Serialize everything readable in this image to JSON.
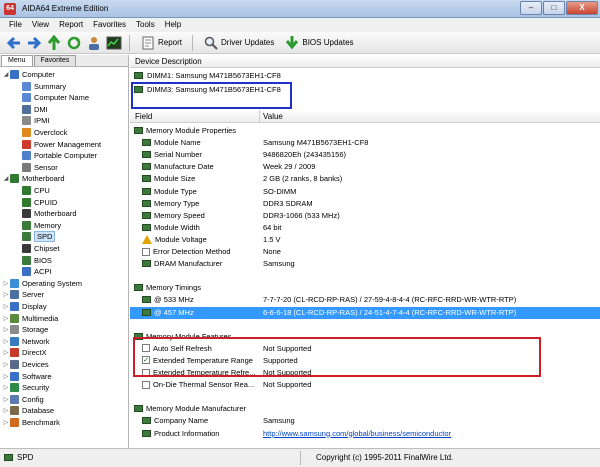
{
  "window": {
    "title": "AIDA64 Extreme Edition",
    "app_icon": "64",
    "minimize": "–",
    "maximize": "□",
    "close": "X"
  },
  "menubar": [
    "File",
    "View",
    "Report",
    "Favorites",
    "Tools",
    "Help"
  ],
  "toolbar": {
    "report": "Report",
    "driver_updates": "Driver Updates",
    "bios_updates": "BIOS Updates"
  },
  "left_tabs": [
    "Menu",
    "Favorites"
  ],
  "tree": [
    {
      "label": "Computer",
      "level": 0,
      "expanded": true,
      "color": "#3a6fc7"
    },
    {
      "label": "Summary",
      "level": 1,
      "color": "#5a87d6"
    },
    {
      "label": "Computer Name",
      "level": 1,
      "color": "#5a87d6"
    },
    {
      "label": "DMI",
      "level": 1,
      "color": "#4f6f9a"
    },
    {
      "label": "IPMI",
      "level": 1,
      "color": "#8a8a8a"
    },
    {
      "label": "Overclock",
      "level": 1,
      "color": "#e08a1e"
    },
    {
      "label": "Power Management",
      "level": 1,
      "color": "#d13b2e"
    },
    {
      "label": "Portable Computer",
      "level": 1,
      "color": "#4f7fc8"
    },
    {
      "label": "Sensor",
      "level": 1,
      "color": "#7a7a7a"
    },
    {
      "label": "Motherboard",
      "level": 0,
      "expanded": true,
      "color": "#2f7a2f"
    },
    {
      "label": "CPU",
      "level": 1,
      "color": "#2f7a2f"
    },
    {
      "label": "CPUID",
      "level": 1,
      "color": "#2f7a2f"
    },
    {
      "label": "Motherboard",
      "level": 1,
      "color": "#3a3a3a"
    },
    {
      "label": "Memory",
      "level": 1,
      "color": "#3c7a3c"
    },
    {
      "label": "SPD",
      "level": 1,
      "color": "#3c7a3c",
      "selected": true
    },
    {
      "label": "Chipset",
      "level": 1,
      "color": "#3a3a3a"
    },
    {
      "label": "BIOS",
      "level": 1,
      "color": "#3a7a3a"
    },
    {
      "label": "ACPI",
      "level": 1,
      "color": "#3a6fc7"
    },
    {
      "label": "Operating System",
      "level": 0,
      "color": "#3a8fd6"
    },
    {
      "label": "Server",
      "level": 0,
      "color": "#4a6fa0"
    },
    {
      "label": "Display",
      "level": 0,
      "color": "#3a6fc7"
    },
    {
      "label": "Multimedia",
      "level": 0,
      "color": "#5a8a3a"
    },
    {
      "label": "Storage",
      "level": 0,
      "color": "#8a8a8a"
    },
    {
      "label": "Network",
      "level": 0,
      "color": "#3a7ac0"
    },
    {
      "label": "DirectX",
      "level": 0,
      "color": "#c83a2a"
    },
    {
      "label": "Devices",
      "level": 0,
      "color": "#5a6a8a"
    },
    {
      "label": "Software",
      "level": 0,
      "color": "#3a6fc7"
    },
    {
      "label": "Security",
      "level": 0,
      "color": "#2f8a4a"
    },
    {
      "label": "Config",
      "level": 0,
      "color": "#5a7ab0"
    },
    {
      "label": "Database",
      "level": 0,
      "color": "#7a6a4a"
    },
    {
      "label": "Benchmark",
      "level": 0,
      "color": "#d06a1e"
    }
  ],
  "device_description": {
    "header": "Device Description",
    "items": [
      "DIMM1: Samsung M471B5673EH1-CF8",
      "DIMM3: Samsung M471B5673EH1-CF8"
    ]
  },
  "columns": {
    "field": "Field",
    "value": "Value"
  },
  "rows": [
    {
      "type": "section",
      "field": "Memory Module Properties"
    },
    {
      "type": "item",
      "icon": "chip",
      "field": "Module Name",
      "value": "Samsung M471B5673EH1-CF8"
    },
    {
      "type": "item",
      "icon": "chip",
      "field": "Serial Number",
      "value": "9486820Eh (243435156)"
    },
    {
      "type": "item",
      "icon": "chip",
      "field": "Manufacture Date",
      "value": "Week 29 / 2009"
    },
    {
      "type": "item",
      "icon": "chip",
      "field": "Module Size",
      "value": "2 GB (2 ranks, 8 banks)"
    },
    {
      "type": "item",
      "icon": "chip",
      "field": "Module Type",
      "value": "SO-DIMM"
    },
    {
      "type": "item",
      "icon": "chip",
      "field": "Memory Type",
      "value": "DDR3 SDRAM"
    },
    {
      "type": "item",
      "icon": "chip",
      "field": "Memory Speed",
      "value": "DDR3-1066 (533 MHz)"
    },
    {
      "type": "item",
      "icon": "chip",
      "field": "Module Width",
      "value": "64 bit"
    },
    {
      "type": "item",
      "icon": "warn",
      "field": "Module Voltage",
      "value": "1.5 V"
    },
    {
      "type": "item",
      "icon": "box",
      "field": "Error Detection Method",
      "value": "None"
    },
    {
      "type": "item",
      "icon": "chip",
      "field": "DRAM Manufacturer",
      "value": "Samsung"
    },
    {
      "type": "blank"
    },
    {
      "type": "section",
      "field": "Memory Timings"
    },
    {
      "type": "item",
      "icon": "chip",
      "field": "@ 533 MHz",
      "value": "7-7-7-20  (CL-RCD-RP-RAS) / 27-59-4-8-4-4  (RC-RFC-RRD-WR-WTR-RTP)"
    },
    {
      "type": "item",
      "icon": "chip",
      "field": "@ 457 MHz",
      "value": "6-6-6-18  (CL-RCD-RP-RAS) / 24-51-4-7-4-4  (RC-RFC-RRD-WR-WTR-RTP)",
      "selected": true
    },
    {
      "type": "blank"
    },
    {
      "type": "section",
      "field": "Memory Module Features"
    },
    {
      "type": "item",
      "icon": "cb",
      "checked": false,
      "field": "Auto Self Refresh",
      "value": "Not Supported"
    },
    {
      "type": "item",
      "icon": "cb",
      "checked": true,
      "field": "Extended Temperature Range",
      "value": "Supported"
    },
    {
      "type": "item",
      "icon": "cb",
      "checked": false,
      "field": "Extended Temperature Refre...",
      "value": "Not Supported"
    },
    {
      "type": "item",
      "icon": "cb",
      "checked": false,
      "field": "On-Die Thermal Sensor Rea...",
      "value": "Not Supported"
    },
    {
      "type": "blank"
    },
    {
      "type": "section",
      "field": "Memory Module Manufacturer"
    },
    {
      "type": "item",
      "icon": "chip",
      "field": "Company Name",
      "value": "Samsung"
    },
    {
      "type": "item",
      "icon": "chip",
      "field": "Product Information",
      "value": "http://www.samsung.com/global/business/semiconductor",
      "link": true
    }
  ],
  "status": {
    "left": "SPD",
    "right": "Copyright (c) 1995-2011 FinalWire Ltd."
  }
}
